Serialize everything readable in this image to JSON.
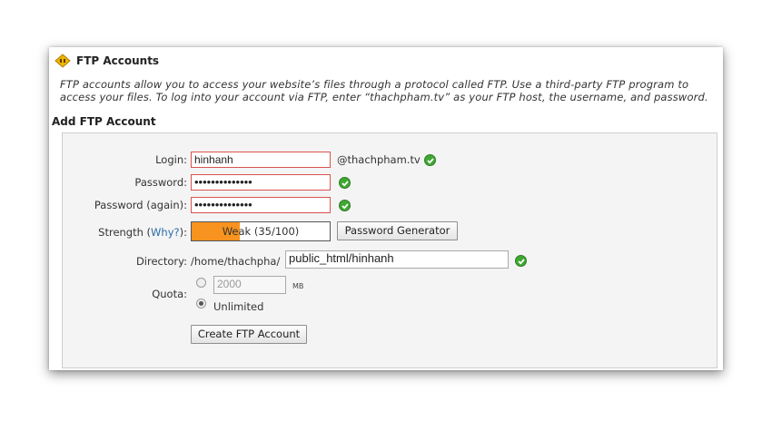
{
  "header": {
    "title": "FTP Accounts",
    "description": "FTP accounts allow you to access your website’s files through a protocol called FTP. Use a third-party FTP program to access your files. To log into your account via FTP, enter “thachpham.tv” as your FTP host, the username, and password."
  },
  "form": {
    "section_title": "Add FTP Account",
    "login": {
      "label": "Login:",
      "value": "hinhanh",
      "domain_suffix": "@thachpham.tv"
    },
    "password": {
      "label": "Password:",
      "masked": "••••••••••••••"
    },
    "password_again": {
      "label": "Password (again):",
      "masked": "••••••••••••••"
    },
    "strength": {
      "label_pre": "Strength (",
      "why_link": "Why?",
      "label_post": "):",
      "text": "Weak (35/100)",
      "score": 35,
      "fill_color": "#f7931e"
    },
    "password_generator_button": "Password Generator",
    "directory": {
      "label": "Directory:",
      "prefix": "/home/thachpha/",
      "value": "public_html/hinhanh"
    },
    "quota": {
      "label": "Quota:",
      "placeholder": "2000",
      "unit": "MB",
      "unlimited_label": "Unlimited",
      "selected": "Unlimited"
    },
    "create_button": "Create FTP Account"
  },
  "colors": {
    "accent_link": "#2a6aa9",
    "valid_check": "#3fa832",
    "error_border": "#d9534f"
  },
  "icons": {
    "title_icon": "ftp-folder-icon",
    "valid": "check-circle-icon"
  }
}
